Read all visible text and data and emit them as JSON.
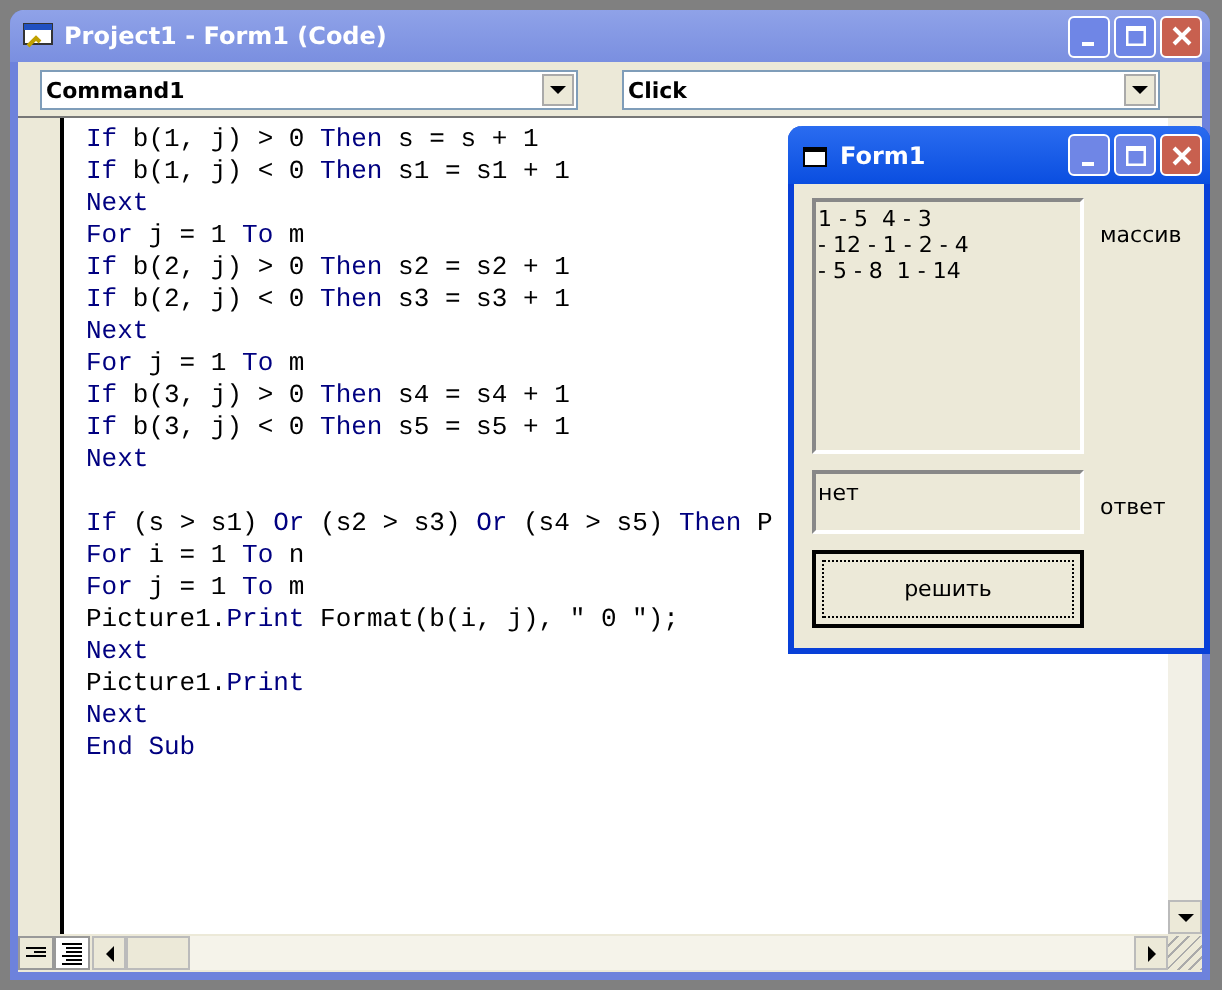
{
  "window": {
    "title": "Project1 - Form1 (Code)"
  },
  "object_dropdown": {
    "value": "Command1"
  },
  "procedure_dropdown": {
    "value": "Click"
  },
  "code_lines": [
    {
      "kind": "code",
      "tokens": [
        {
          "text": "If",
          "kind": "keyword"
        },
        {
          "text": " b(1, j) > 0 ",
          "kind": "plain"
        },
        {
          "text": "Then",
          "kind": "keyword"
        },
        {
          "text": " s = s + 1",
          "kind": "plain"
        }
      ]
    },
    {
      "kind": "code",
      "tokens": [
        {
          "text": "If",
          "kind": "keyword"
        },
        {
          "text": " b(1, j) < 0 ",
          "kind": "plain"
        },
        {
          "text": "Then",
          "kind": "keyword"
        },
        {
          "text": " s1 = s1 + 1",
          "kind": "plain"
        }
      ]
    },
    {
      "kind": "code",
      "tokens": [
        {
          "text": "Next",
          "kind": "keyword"
        }
      ]
    },
    {
      "kind": "code",
      "tokens": [
        {
          "text": "For",
          "kind": "keyword"
        },
        {
          "text": " j = 1 ",
          "kind": "plain"
        },
        {
          "text": "To",
          "kind": "keyword"
        },
        {
          "text": " m",
          "kind": "plain"
        }
      ]
    },
    {
      "kind": "code",
      "tokens": [
        {
          "text": "If",
          "kind": "keyword"
        },
        {
          "text": " b(2, j) > 0 ",
          "kind": "plain"
        },
        {
          "text": "Then",
          "kind": "keyword"
        },
        {
          "text": " s2 = s2 + 1",
          "kind": "plain"
        }
      ]
    },
    {
      "kind": "code",
      "tokens": [
        {
          "text": "If",
          "kind": "keyword"
        },
        {
          "text": " b(2, j) < 0 ",
          "kind": "plain"
        },
        {
          "text": "Then",
          "kind": "keyword"
        },
        {
          "text": " s3 = s3 + 1",
          "kind": "plain"
        }
      ]
    },
    {
      "kind": "code",
      "tokens": [
        {
          "text": "Next",
          "kind": "keyword"
        }
      ]
    },
    {
      "kind": "code",
      "tokens": [
        {
          "text": "For",
          "kind": "keyword"
        },
        {
          "text": " j = 1 ",
          "kind": "plain"
        },
        {
          "text": "To",
          "kind": "keyword"
        },
        {
          "text": " m",
          "kind": "plain"
        }
      ]
    },
    {
      "kind": "code",
      "tokens": [
        {
          "text": "If",
          "kind": "keyword"
        },
        {
          "text": " b(3, j) > 0 ",
          "kind": "plain"
        },
        {
          "text": "Then",
          "kind": "keyword"
        },
        {
          "text": " s4 = s4 + 1",
          "kind": "plain"
        }
      ]
    },
    {
      "kind": "code",
      "tokens": [
        {
          "text": "If",
          "kind": "keyword"
        },
        {
          "text": " b(3, j) < 0 ",
          "kind": "plain"
        },
        {
          "text": "Then",
          "kind": "keyword"
        },
        {
          "text": " s5 = s5 + 1",
          "kind": "plain"
        }
      ]
    },
    {
      "kind": "code",
      "tokens": [
        {
          "text": "Next",
          "kind": "keyword"
        }
      ]
    },
    {
      "kind": "blank"
    },
    {
      "kind": "code",
      "tokens": [
        {
          "text": "If",
          "kind": "keyword"
        },
        {
          "text": " (s > s1) ",
          "kind": "plain"
        },
        {
          "text": "Or",
          "kind": "keyword"
        },
        {
          "text": " (s2 > s3) ",
          "kind": "plain"
        },
        {
          "text": "Or",
          "kind": "keyword"
        },
        {
          "text": " (s4 > s5) ",
          "kind": "plain"
        },
        {
          "text": "Then",
          "kind": "keyword"
        },
        {
          "text": " P",
          "kind": "plain"
        }
      ]
    },
    {
      "kind": "code",
      "tokens": [
        {
          "text": "For",
          "kind": "keyword"
        },
        {
          "text": " i = 1 ",
          "kind": "plain"
        },
        {
          "text": "To",
          "kind": "keyword"
        },
        {
          "text": " n",
          "kind": "plain"
        }
      ]
    },
    {
      "kind": "code",
      "tokens": [
        {
          "text": "For",
          "kind": "keyword"
        },
        {
          "text": " j = 1 ",
          "kind": "plain"
        },
        {
          "text": "To",
          "kind": "keyword"
        },
        {
          "text": " m",
          "kind": "plain"
        }
      ]
    },
    {
      "kind": "code",
      "tokens": [
        {
          "text": "Picture1.",
          "kind": "plain"
        },
        {
          "text": "Print",
          "kind": "keyword"
        },
        {
          "text": " Format(b(i, j), \" 0 \");",
          "kind": "plain"
        }
      ]
    },
    {
      "kind": "code",
      "tokens": [
        {
          "text": "Next",
          "kind": "keyword"
        }
      ]
    },
    {
      "kind": "code",
      "tokens": [
        {
          "text": "Picture1.",
          "kind": "plain"
        },
        {
          "text": "Print",
          "kind": "keyword"
        }
      ]
    },
    {
      "kind": "code",
      "tokens": [
        {
          "text": "Next",
          "kind": "keyword"
        }
      ]
    },
    {
      "kind": "code",
      "tokens": [
        {
          "text": "End Sub",
          "kind": "keyword"
        }
      ]
    }
  ],
  "form": {
    "title": "Form1",
    "picture_lines": [
      "1 - 5  4 - 3",
      "- 12 - 1 - 2 - 4",
      "- 5 - 8  1 - 14"
    ],
    "picture_label": "массив",
    "answer_value": "нет",
    "answer_label": "ответ",
    "button": "решить"
  }
}
